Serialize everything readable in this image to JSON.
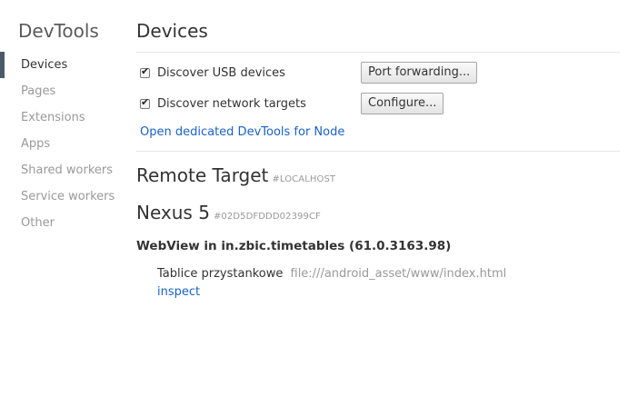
{
  "sidebar": {
    "title": "DevTools",
    "items": [
      {
        "label": "Devices",
        "selected": true
      },
      {
        "label": "Pages"
      },
      {
        "label": "Extensions"
      },
      {
        "label": "Apps"
      },
      {
        "label": "Shared workers"
      },
      {
        "label": "Service workers"
      },
      {
        "label": "Other"
      }
    ]
  },
  "main": {
    "title": "Devices",
    "options": {
      "usb": {
        "label": "Discover USB devices",
        "checked": true,
        "button": "Port forwarding..."
      },
      "network": {
        "label": "Discover network targets",
        "checked": true,
        "button": "Configure..."
      }
    },
    "node_link": "Open dedicated DevTools for Node",
    "remote_target": {
      "title": "Remote Target",
      "tag": "#LOCALHOST"
    },
    "device": {
      "name": "Nexus 5",
      "serial": "#02D5DFDDD02399CF"
    },
    "browser": {
      "title": "WebView in in.zbic.timetables (61.0.3163.98)"
    },
    "page": {
      "name": "Tablice przystankowe",
      "url": "file:///android_asset/www/index.html",
      "action": "inspect"
    }
  },
  "colors": {
    "link": "#1a62c6",
    "muted": "#999999",
    "text": "#333333",
    "selected_marker": "#4a5a6b"
  }
}
